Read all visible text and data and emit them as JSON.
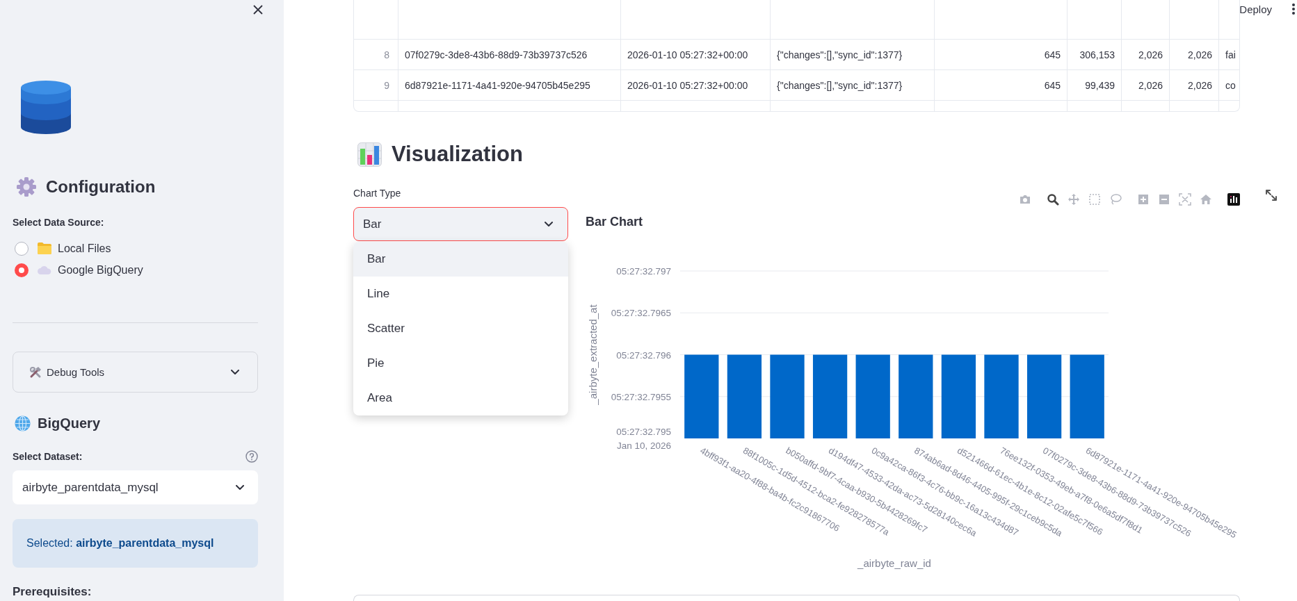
{
  "sidebar": {
    "heading": "Configuration",
    "data_source": {
      "label": "Select Data Source:",
      "options": [
        {
          "label": "Local Files",
          "selected": false
        },
        {
          "label": "Google BigQuery",
          "selected": true
        }
      ]
    },
    "debug_tools": {
      "label": "Debug Tools",
      "expanded": false
    },
    "section_heading": "BigQuery",
    "dataset": {
      "label": "Select Dataset:",
      "value": "airbyte_parentdata_mysql"
    },
    "info": "Selected: **airbyte_parentdata_mysql**",
    "prerequisites": "Prerequisites:"
  },
  "header": {
    "deploy": "Deploy"
  },
  "table": {
    "rows": [
      {
        "index": "8",
        "cells": [
          "07f0279c-3de8-43b6-88d9-73b39737c526",
          "2026-01-10 05:27:32+00:00",
          "{\"changes\":[],\"sync_id\":1377}",
          "645",
          "306,153",
          "2,026",
          "2,026",
          "fai"
        ]
      },
      {
        "index": "9",
        "cells": [
          "6d87921e-1171-4a41-920e-94705b45e295",
          "2026-01-10 05:27:32+00:00",
          "{\"changes\":[],\"sync_id\":1377}",
          "645",
          "99,439",
          "2,026",
          "2,026",
          "co"
        ]
      }
    ]
  },
  "visualization": {
    "heading": "Visualization",
    "chart_type": {
      "label": "Chart Type",
      "value": "Bar",
      "expanded": true,
      "options": [
        {
          "label": "Bar",
          "selected": true
        },
        {
          "label": "Line",
          "selected": false
        },
        {
          "label": "Scatter",
          "selected": false
        },
        {
          "label": "Pie",
          "selected": false
        },
        {
          "label": "Area",
          "selected": false
        }
      ]
    },
    "chart": {
      "title": "Bar Chart",
      "xlabel": "_airbyte_raw_id",
      "ylabel": "_airbyte_extracted_at",
      "y_tick_labels": [
        "05:27:32.797",
        "05:27:32.7965",
        "05:27:32.796",
        "05:27:32.7955",
        "05:27:32.795\nJan 10, 2026"
      ],
      "categories": [
        "4bff93f1-aa20-4f88-ba4b-fc2c91867706",
        "88f1005c-1d5d-4512-bca2-fe928278577a",
        "b050affd-9bf7-4caa-b930-5b4428269fc7",
        "d194df47-4533-42da-ac73-5d28140cec6a",
        "0c9a42ca-86f3-4c76-bb9c-16a13c434d87",
        "874ab6ad-8d46-4405-995f-29c1ceb9c5da",
        "d521466d-61ec-4b1e-8c12-02afe5c7f566",
        "76ee132f-0353-49eb-a7f8-0e6a5df7f8d1",
        "07f0279c-3de8-43b6-88d9-73b39737c526",
        "6d87921e-1171-4a41-920e-94705b45e295"
      ]
    }
  }
}
